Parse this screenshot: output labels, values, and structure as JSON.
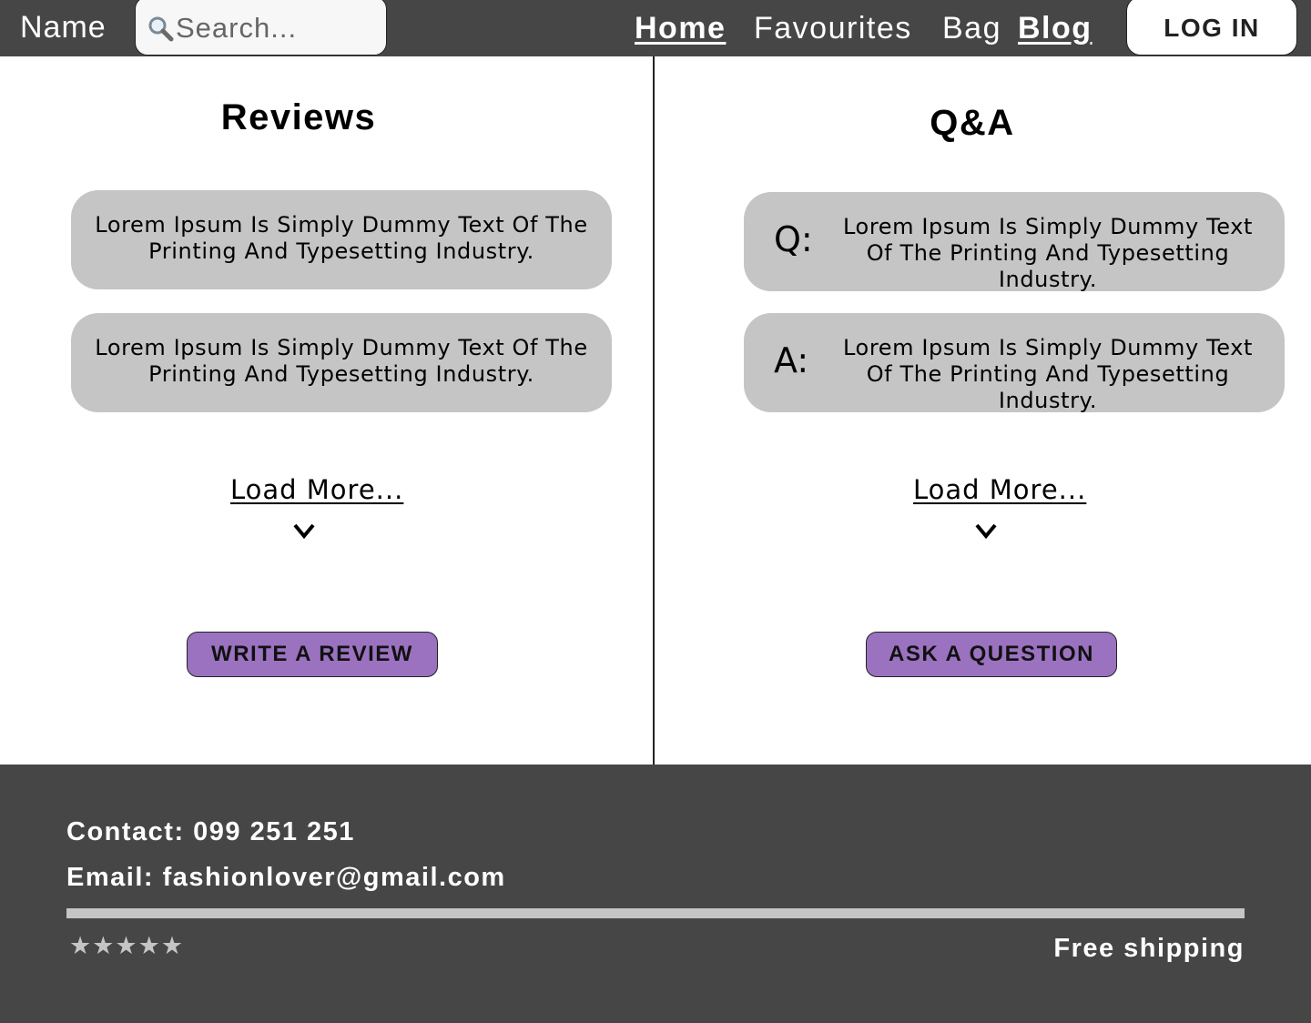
{
  "header": {
    "brand": "Name",
    "search": {
      "placeholder": "Search..."
    },
    "nav": [
      {
        "label": "Home",
        "active": true
      },
      {
        "label": "Favourites",
        "active": false
      },
      {
        "label": "Bag",
        "active": false
      },
      {
        "label": "Blog",
        "active": true
      }
    ],
    "login_label": "LOG IN"
  },
  "reviews": {
    "title": "Reviews",
    "items": [
      "Lorem Ipsum Is Simply Dummy Text Of The Printing And Typesetting Industry.",
      "Lorem Ipsum Is Simply Dummy Text Of The Printing And Typesetting Industry."
    ],
    "load_more": "Load More...",
    "button_label": "WRITE A REVIEW"
  },
  "qa": {
    "title": "Q&A",
    "question": {
      "prefix": "Q:",
      "text": "Lorem Ipsum Is Simply Dummy Text Of The Printing And Typesetting Industry."
    },
    "answer": {
      "prefix": "A:",
      "text": "Lorem Ipsum Is Simply Dummy Text Of The Printing And Typesetting Industry."
    },
    "load_more": "Load More...",
    "button_label": "ASK A QUESTION"
  },
  "footer": {
    "contact": "Contact: 099 251 251",
    "email": "Email: fashionlover@gmail.com",
    "stars": "★★★★★",
    "shipping": "Free shipping"
  },
  "colors": {
    "header_bg": "#464646",
    "card_bg": "#c5c5c5",
    "button_accent": "#9b72c0",
    "footer_bg": "#464646"
  },
  "icons": [
    "search-icon",
    "chevron-down-icon"
  ]
}
